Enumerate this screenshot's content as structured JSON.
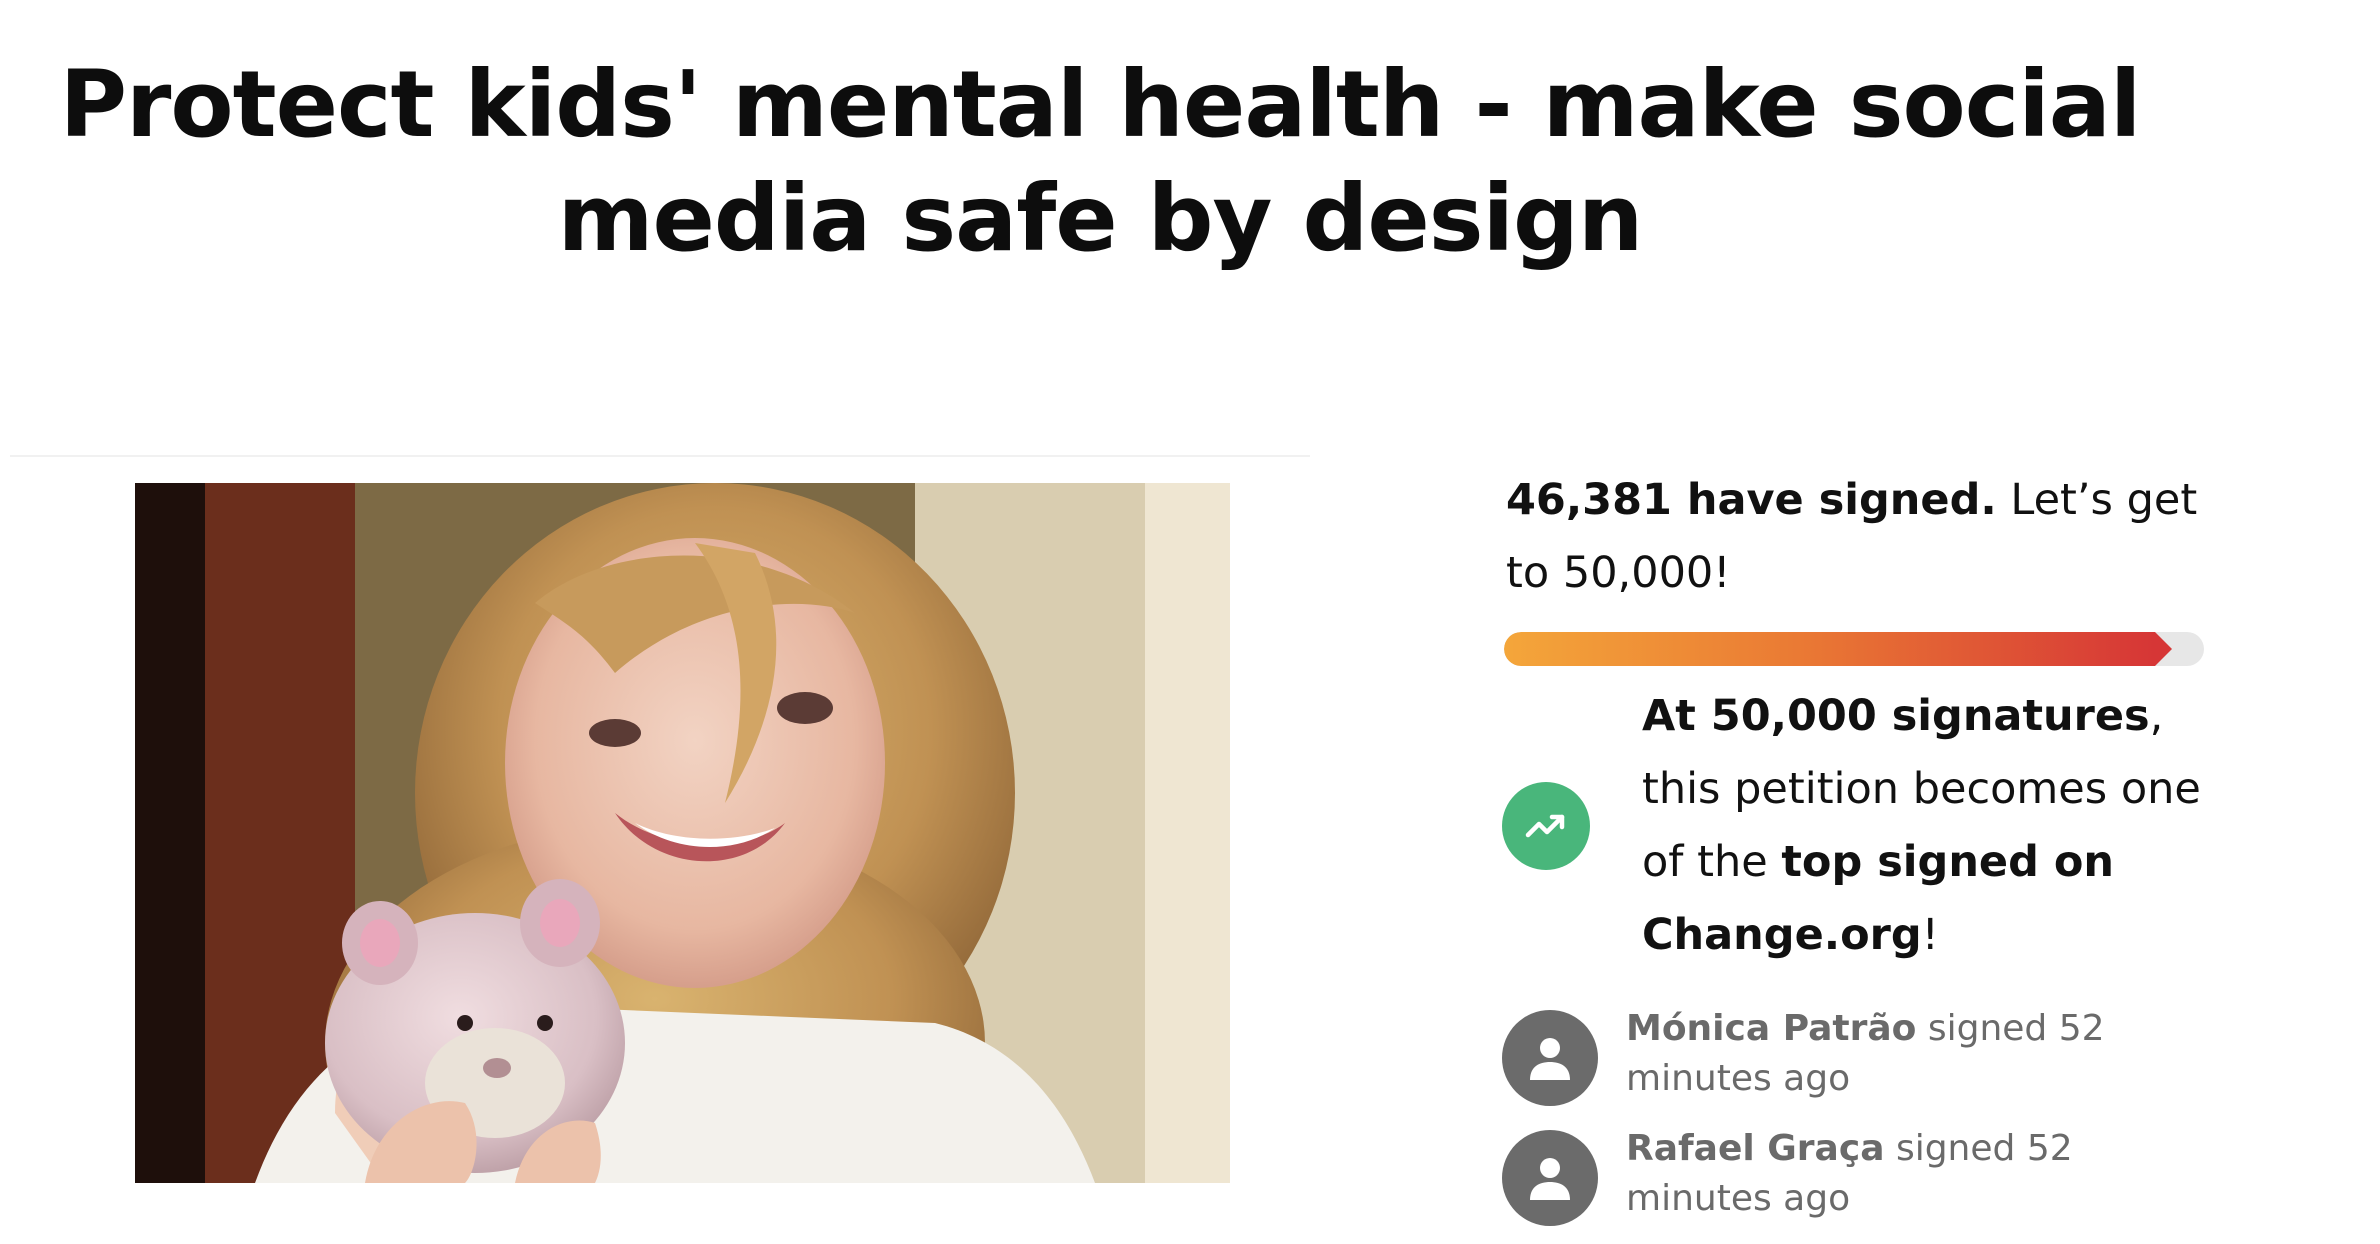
{
  "petition": {
    "title": "Protect kids' mental health - make social media safe by design",
    "photo_alt": "Smiling child holding a pink teddy bear"
  },
  "progress": {
    "count_text": "46,381 have signed.",
    "goal_text": "Let’s get to 50,000!",
    "signed": 46381,
    "goal": 50000,
    "fraction": 0.93,
    "colors": {
      "start": "#f4a63a",
      "end": "#d63636",
      "track": "#e7e7e7"
    }
  },
  "milestone": {
    "bold_1": "At 50,000 signatures",
    "text_1": ", this petition becomes one of the ",
    "bold_2": "top signed on Change.org",
    "text_2": "!",
    "icon": "trending-up-icon",
    "icon_color": "#49b67b"
  },
  "recent_signers": [
    {
      "name": "Mónica Patrão",
      "activity": " signed 52 minutes ago"
    },
    {
      "name": "Rafael Graça",
      "activity": " signed 52 minutes ago"
    }
  ]
}
